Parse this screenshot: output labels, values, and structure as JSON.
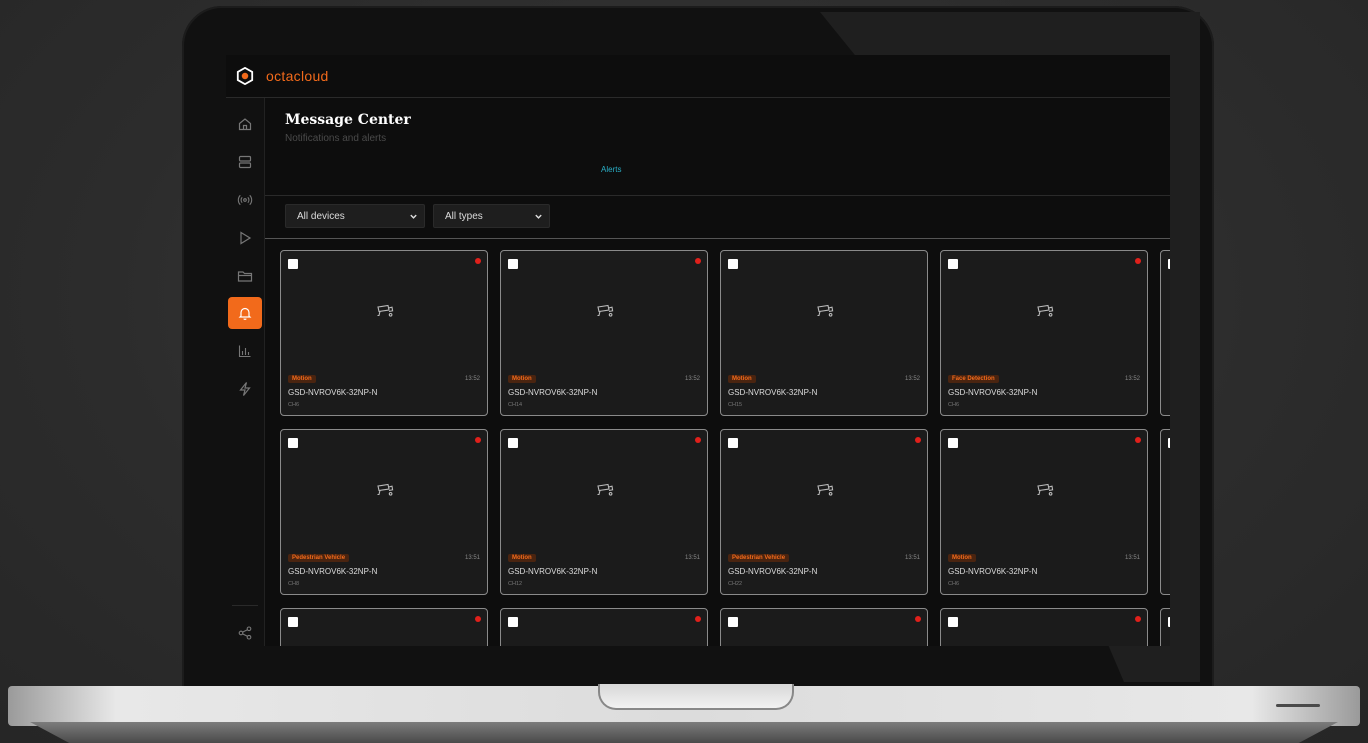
{
  "app": {
    "brand": "octacloud"
  },
  "page": {
    "title": "Message Center",
    "subtitle": "Notifications and alerts",
    "tab": "Alerts"
  },
  "sidebar": {
    "items": [
      {
        "icon": "home-icon"
      },
      {
        "icon": "storage-icon"
      },
      {
        "icon": "broadcast-icon"
      },
      {
        "icon": "play-icon"
      },
      {
        "icon": "folder-icon"
      },
      {
        "icon": "bell-icon",
        "active": true
      },
      {
        "icon": "chart-icon"
      },
      {
        "icon": "lightning-icon"
      }
    ],
    "footer_icon": "share-icon"
  },
  "filters": {
    "device": "All devices",
    "type": "All types"
  },
  "colors": {
    "accent": "#f26a1b",
    "alert_dot": "#e0201b",
    "link": "#2ab0c8"
  },
  "cards": [
    {
      "tag": "Motion",
      "time": "13:52",
      "device": "GSD-NVROV6K-32NP-N",
      "channel": "CH6",
      "unread": true
    },
    {
      "tag": "Motion",
      "time": "13:52",
      "device": "GSD-NVROV6K-32NP-N",
      "channel": "CH14",
      "unread": true
    },
    {
      "tag": "Motion",
      "time": "13:52",
      "device": "GSD-NVROV6K-32NP-N",
      "channel": "CH15",
      "unread": false
    },
    {
      "tag": "Face Detection",
      "time": "13:52",
      "device": "GSD-NVROV6K-32NP-N",
      "channel": "CH6",
      "unread": true
    },
    {
      "tag": "Pedestrian Vehicle",
      "time": "13:51",
      "device": "GSD-NVROV6K-32NP-N",
      "channel": "CH8",
      "unread": true
    },
    {
      "tag": "Motion",
      "time": "13:51",
      "device": "GSD-NVROV6K-32NP-N",
      "channel": "CH12",
      "unread": true
    },
    {
      "tag": "Pedestrian Vehicle",
      "time": "13:51",
      "device": "GSD-NVROV6K-32NP-N",
      "channel": "CH22",
      "unread": true
    },
    {
      "tag": "Motion",
      "time": "13:51",
      "device": "GSD-NVROV6K-32NP-N",
      "channel": "CH6",
      "unread": true
    },
    {
      "unread": true
    },
    {
      "unread": true
    },
    {
      "unread": true
    },
    {
      "unread": true
    }
  ]
}
